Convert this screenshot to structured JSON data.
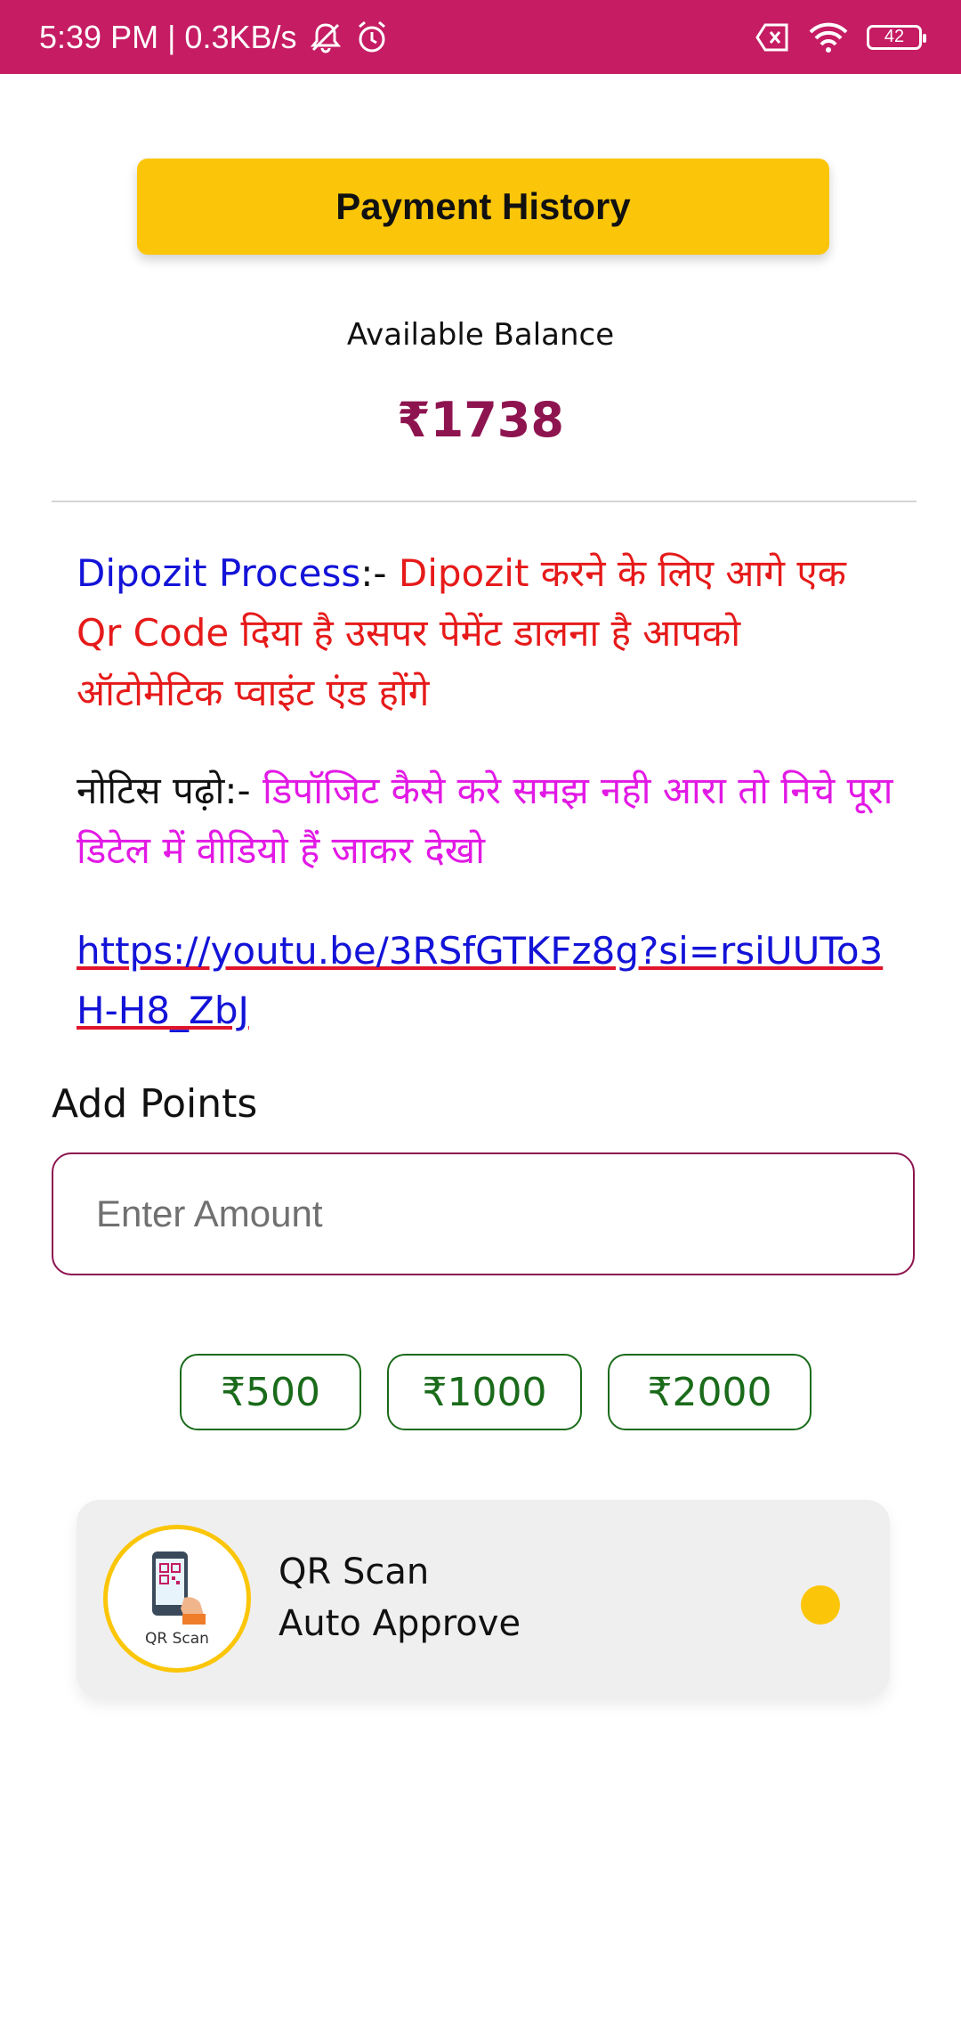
{
  "status_bar": {
    "time_speed": "5:39 PM | 0.3KB/s",
    "battery": "42"
  },
  "header": {
    "payment_history_label": "Payment History"
  },
  "balance": {
    "label": "Available Balance",
    "value": "₹1738"
  },
  "notice": {
    "deposit_heading": "Dipozit Process",
    "deposit_separator": ":- ",
    "deposit_text": "Dipozit करने के लिए आगे एक Qr Code दिया है उसपर पेमेंट डालना है आपको ऑटोमेटिक प्वाइंट एंड होंगे",
    "notice_heading": "नोटिस पढ़ो:- ",
    "notice_text": "डिपॉजिट कैसे करे समझ नही आरा तो निचे पूरा डिटेल में वीडियो हैं जाकर देखो",
    "video_link": "https://youtu.be/3RSfGTKFz8g?si=rsiUUTo3H-H8_ZbJ"
  },
  "add_points": {
    "label": "Add Points",
    "placeholder": "Enter Amount",
    "quick_amounts": [
      "₹500",
      "₹1000",
      "₹2000"
    ]
  },
  "payment_method": {
    "icon_caption": "QR Scan",
    "title": "QR Scan",
    "subtitle": "Auto Approve"
  },
  "colors": {
    "status_bar": "#c51c63",
    "primary_button": "#fbc60a",
    "balance_text": "#8e1450",
    "chip_green": "#1a6b1a"
  }
}
